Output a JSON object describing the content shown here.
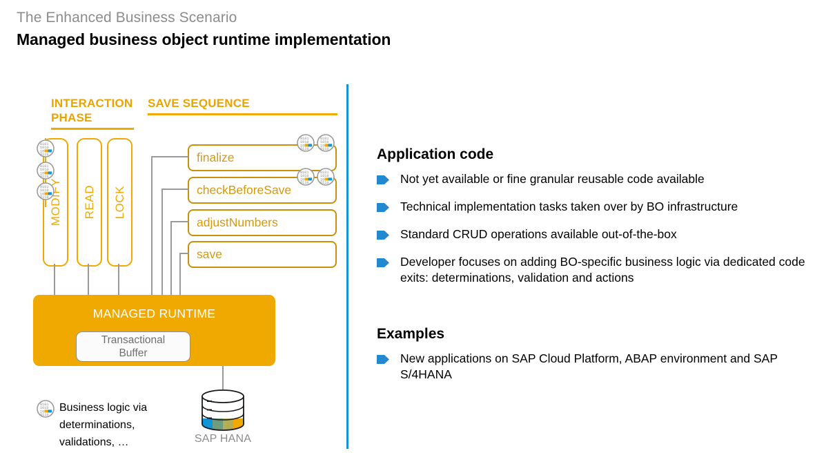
{
  "header": {
    "kicker": "The Enhanced Business Scenario",
    "title": "Managed business object runtime implementation"
  },
  "diagram": {
    "column_headers": {
      "interaction": "INTERACTION PHASE",
      "save": "SAVE SEQUENCE"
    },
    "phases": [
      {
        "label": "MODIFY"
      },
      {
        "label": "READ"
      },
      {
        "label": "LOCK"
      }
    ],
    "save_sequence": [
      {
        "label": "finalize",
        "code_icons": 2
      },
      {
        "label": "checkBeforeSave",
        "code_icons": 2
      },
      {
        "label": "adjustNumbers",
        "code_icons": 0
      },
      {
        "label": "save",
        "code_icons": 0
      }
    ],
    "runtime": {
      "label": "MANAGED RUNTIME",
      "buffer_line1": "Transactional",
      "buffer_line2": "Buffer"
    },
    "database": {
      "label": "SAP HANA"
    },
    "legend": {
      "line1": "Business logic via",
      "line2": "determinations,",
      "line3": "validations, …"
    }
  },
  "panel": {
    "application_code": {
      "title": "Application code",
      "bullets": [
        "Not yet available or fine granular reusable code available",
        "Technical implementation tasks taken over by BO infrastructure",
        "Standard CRUD operations available out-of-the-box",
        "Developer focuses on adding BO-specific business logic via dedicated code exits: determinations, validation and actions"
      ]
    },
    "examples": {
      "title": "Examples",
      "bullets": [
        "New applications on SAP Cloud Platform, ABAP environment and SAP S/4HANA"
      ]
    }
  },
  "colors": {
    "orange": "#EFA900",
    "orange_dark": "#C8900A",
    "blue": "#1195d6",
    "bullet_blue": "#2288d0",
    "gray_text": "#8c8c8c",
    "connector_gray": "#9a9a9a"
  }
}
